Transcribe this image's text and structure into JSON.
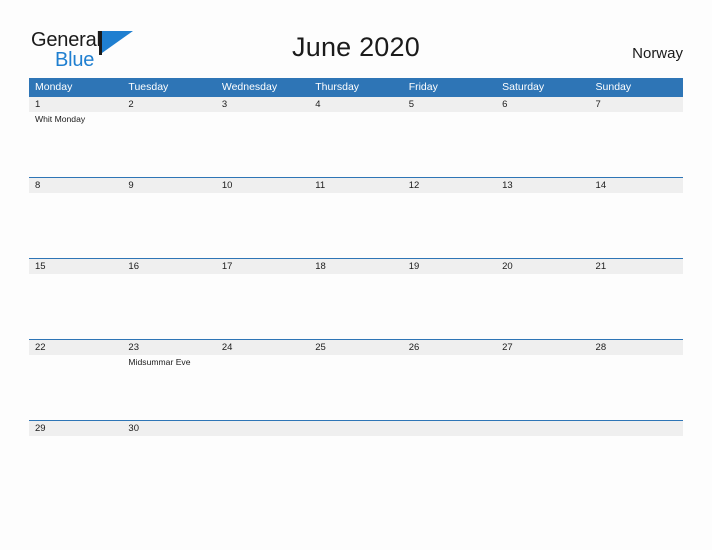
{
  "brand": {
    "name_part1": "General",
    "name_part2": "Blue",
    "flag_color": "#1f7fd0"
  },
  "header": {
    "title": "June 2020",
    "country": "Norway"
  },
  "theme": {
    "header_blue": "#2e75b6",
    "date_band_gray": "#efefef",
    "page_background": "#fdfdfd",
    "text_color": "#1b1b1b"
  },
  "calendar": {
    "weekdays": [
      "Monday",
      "Tuesday",
      "Wednesday",
      "Thursday",
      "Friday",
      "Saturday",
      "Sunday"
    ],
    "weeks": [
      {
        "days": [
          {
            "num": "1",
            "event": "Whit Monday"
          },
          {
            "num": "2",
            "event": ""
          },
          {
            "num": "3",
            "event": ""
          },
          {
            "num": "4",
            "event": ""
          },
          {
            "num": "5",
            "event": ""
          },
          {
            "num": "6",
            "event": ""
          },
          {
            "num": "7",
            "event": ""
          }
        ]
      },
      {
        "days": [
          {
            "num": "8",
            "event": ""
          },
          {
            "num": "9",
            "event": ""
          },
          {
            "num": "10",
            "event": ""
          },
          {
            "num": "11",
            "event": ""
          },
          {
            "num": "12",
            "event": ""
          },
          {
            "num": "13",
            "event": ""
          },
          {
            "num": "14",
            "event": ""
          }
        ]
      },
      {
        "days": [
          {
            "num": "15",
            "event": ""
          },
          {
            "num": "16",
            "event": ""
          },
          {
            "num": "17",
            "event": ""
          },
          {
            "num": "18",
            "event": ""
          },
          {
            "num": "19",
            "event": ""
          },
          {
            "num": "20",
            "event": ""
          },
          {
            "num": "21",
            "event": ""
          }
        ]
      },
      {
        "days": [
          {
            "num": "22",
            "event": ""
          },
          {
            "num": "23",
            "event": "Midsummar Eve"
          },
          {
            "num": "24",
            "event": ""
          },
          {
            "num": "25",
            "event": ""
          },
          {
            "num": "26",
            "event": ""
          },
          {
            "num": "27",
            "event": ""
          },
          {
            "num": "28",
            "event": ""
          }
        ]
      },
      {
        "days": [
          {
            "num": "29",
            "event": ""
          },
          {
            "num": "30",
            "event": ""
          },
          {
            "num": "",
            "event": ""
          },
          {
            "num": "",
            "event": ""
          },
          {
            "num": "",
            "event": ""
          },
          {
            "num": "",
            "event": ""
          },
          {
            "num": "",
            "event": ""
          }
        ]
      }
    ]
  }
}
